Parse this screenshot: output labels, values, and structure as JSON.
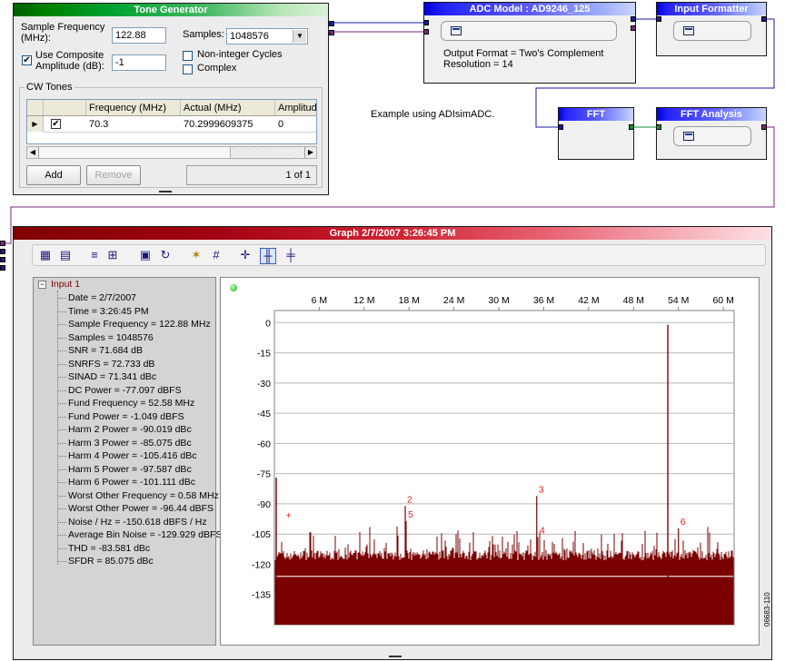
{
  "tone_generator": {
    "title": "Tone Generator",
    "sample_freq_label": "Sample Frequency (MHz):",
    "sample_freq_value": "122.88",
    "samples_label": "Samples:",
    "samples_value": "1048576",
    "use_composite_label": "Use Composite Amplitude (dB):",
    "composite_value": "-1",
    "non_integer_label": "Non-integer Cycles",
    "complex_label": "Complex",
    "cw_tones_label": "CW Tones",
    "columns": [
      "Frequency (MHz)",
      "Actual (MHz)",
      "Amplitude"
    ],
    "row": {
      "frequency": "70.3",
      "actual": "70.2999609375",
      "amplitude": "0"
    },
    "add_label": "Add",
    "remove_label": "Remove",
    "pager": "1 of 1"
  },
  "adc_model": {
    "title": "ADC Model : AD9246_125",
    "output_format": "Output Format = Two's Complement",
    "resolution": "Resolution = 14"
  },
  "input_formatter": {
    "title": "Input Formatter"
  },
  "fft": {
    "title": "FFT"
  },
  "fft_analysis": {
    "title": "FFT Analysis"
  },
  "example_note": "Example using ADIsimADC.",
  "graph": {
    "title": "Graph 2/7/2007 3:26:45 PM",
    "tree_root": "Input 1",
    "tree_items": [
      "Date = 2/7/2007",
      "Time = 3:26:45 PM",
      "Sample Frequency = 122.88 MHz",
      "Samples = 1048576",
      "SNR = 71.684 dB",
      "SNRFS = 72.733 dB",
      "SINAD = 71.341 dBc",
      "DC Power = -77.097 dBFS",
      "Fund Frequency = 52.58 MHz",
      "Fund Power = -1.049 dBFS",
      "Harm 2 Power = -90.019 dBc",
      "Harm 3 Power = -85.075 dBc",
      "Harm 4 Power = -105.416 dBc",
      "Harm 5 Power = -97.587 dBc",
      "Harm 6 Power = -101.111 dBc",
      "Worst Other Frequency = 0.58 MHz",
      "Worst Other Power = -96.44 dBFS",
      "Noise / Hz = -150.618 dBFS / Hz",
      "Average Bin Noise = -129.929 dBFS",
      "THD = -83.581 dBc",
      "SFDR = 85.075 dBc"
    ]
  },
  "chart_data": {
    "type": "line",
    "x_ticks": [
      "6 M",
      "12 M",
      "18 M",
      "24 M",
      "30 M",
      "36 M",
      "42 M",
      "48 M",
      "54 M",
      "60 M"
    ],
    "x_tick_values": [
      6,
      12,
      18,
      24,
      30,
      36,
      42,
      48,
      54,
      60
    ],
    "y_ticks": [
      "0",
      "-15",
      "-30",
      "-45",
      "-60",
      "-75",
      "-90",
      "-105",
      "-120",
      "-135"
    ],
    "y_tick_values": [
      0,
      -15,
      -30,
      -45,
      -60,
      -75,
      -90,
      -105,
      -120,
      -135
    ],
    "xlim": [
      0,
      61.44
    ],
    "ylim": [
      -150,
      6
    ],
    "noise_floor": -120,
    "fundamental": {
      "x": 52.58,
      "y": -1.049
    },
    "harmonics": [
      {
        "label": "2",
        "x": 17.49,
        "y": -91.1
      },
      {
        "label": "3",
        "x": 35.06,
        "y": -86.1
      },
      {
        "label": "4",
        "x": 35.2,
        "y": -106.5
      },
      {
        "label": "5",
        "x": 17.6,
        "y": -98.6
      },
      {
        "label": "6",
        "x": 54.0,
        "y": -102.2
      }
    ],
    "worst_other": {
      "label": "+",
      "x": 0.58,
      "y": -96.44
    },
    "color": "#7a0000",
    "grid": true
  },
  "side_id": "06683-110"
}
